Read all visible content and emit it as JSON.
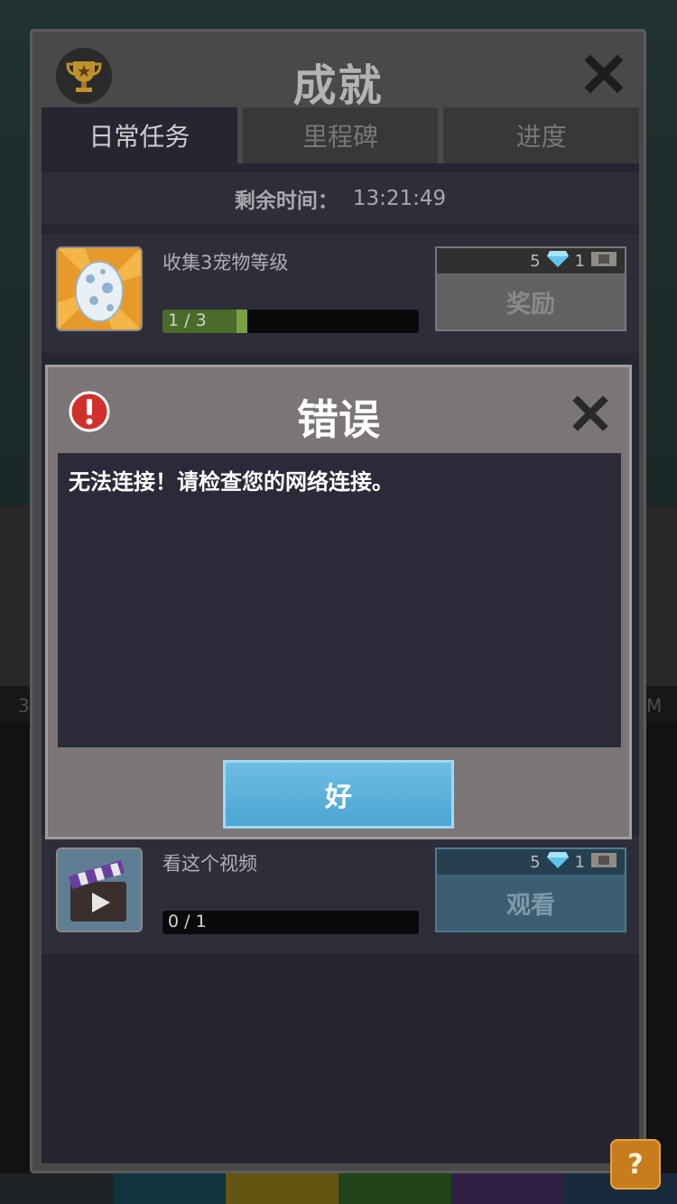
{
  "achievements": {
    "title": "成就",
    "tabs": [
      {
        "label": "日常任务",
        "active": true
      },
      {
        "label": "里程碑",
        "active": false
      },
      {
        "label": "进度",
        "active": false
      }
    ],
    "timer": {
      "label": "剩余时间：",
      "value": "13:21:49"
    },
    "tasks": [
      {
        "name": "收集3宠物等级",
        "progress_text": "1 / 3",
        "progress": 0.33,
        "reward_gems": "5",
        "reward_tickets": "1",
        "button_label": "奖励",
        "icon": "pet-egg-icon"
      },
      {
        "name": "看这个视频",
        "progress_text": "0 / 1",
        "progress": 0,
        "reward_gems": "5",
        "reward_tickets": "1",
        "button_label": "观看",
        "icon": "video-clapper-icon"
      }
    ]
  },
  "dialog": {
    "title": "错误",
    "message": "无法连接！请检查您的网络连接。",
    "ok_label": "好"
  },
  "background": {
    "left_label": "3",
    "right_label": "M"
  },
  "help": {
    "label": "?"
  },
  "colors": {
    "ok_button": "#5db1dc",
    "error_red": "#d2302a",
    "progress_green": "#7aa141",
    "help_orange": "#c77d1d"
  }
}
